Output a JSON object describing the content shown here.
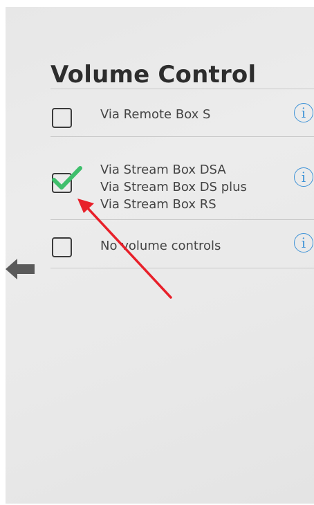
{
  "screen": {
    "title": "Volume Control",
    "options": [
      {
        "label": "Via Remote Box S",
        "checked": false
      },
      {
        "lines": [
          "Via Stream Box DSA",
          "Via Stream Box DS plus",
          "Via Stream Box RS"
        ],
        "checked": true
      },
      {
        "label": "No volume controls",
        "checked": false
      }
    ],
    "info_glyph": "i"
  },
  "icons": {
    "check": "checkmark-icon",
    "info": "info-icon",
    "back": "back-arrow-icon"
  },
  "colors": {
    "check": "#3fbf6c",
    "info": "#3f93d7",
    "annotation_arrow": "#e8202a"
  }
}
